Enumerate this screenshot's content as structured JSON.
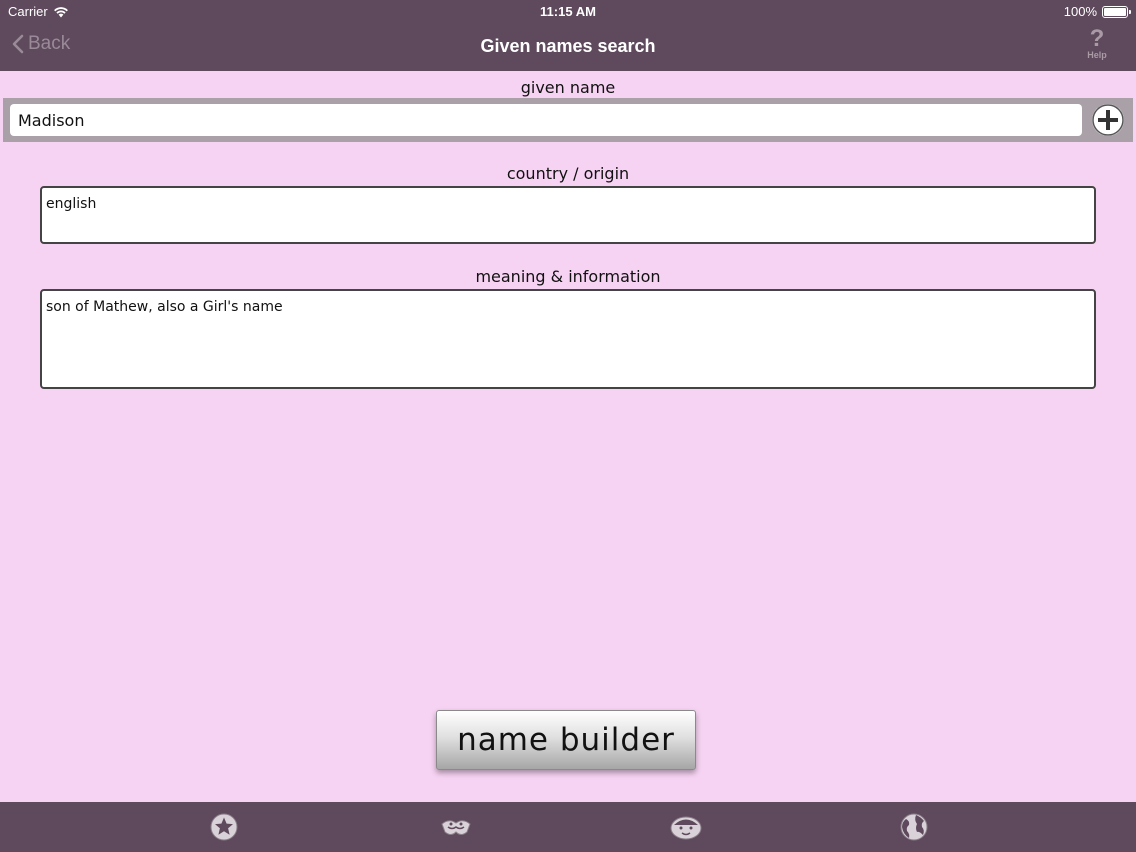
{
  "status_bar": {
    "carrier": "Carrier",
    "time": "11:15 AM",
    "battery": "100%"
  },
  "nav": {
    "back_label": "Back",
    "title": "Given names search",
    "help_label": "Help",
    "help_glyph": "?"
  },
  "form": {
    "given_name_label": "given name",
    "given_name_value": "Madison",
    "country_label": "country / origin",
    "country_value": "english",
    "meaning_label": "meaning & information",
    "meaning_value": "son of Mathew, also a Girl's name"
  },
  "name_builder_label": "name builder",
  "tabs": [
    {
      "icon": "star-icon"
    },
    {
      "icon": "handshake-icon"
    },
    {
      "icon": "baby-face-icon"
    },
    {
      "icon": "globe-icon"
    }
  ],
  "colors": {
    "bar": "#5e4a5c",
    "background": "#f7d3f3",
    "search_strip": "#a9a0a8"
  }
}
